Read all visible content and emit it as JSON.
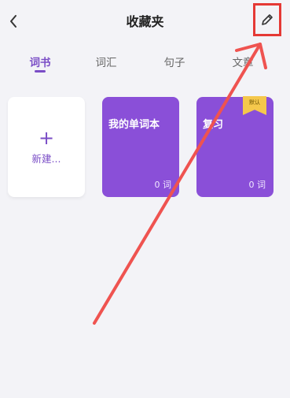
{
  "header": {
    "title": "收藏夹",
    "back_icon": "chevron-left-icon",
    "edit_icon": "pencil-icon"
  },
  "tabs": [
    {
      "label": "词书",
      "active": true
    },
    {
      "label": "词汇",
      "active": false
    },
    {
      "label": "句子",
      "active": false
    },
    {
      "label": "文章",
      "active": false
    }
  ],
  "cards": {
    "new_card": {
      "plus": "+",
      "label": "新建..."
    },
    "books": [
      {
        "name": "我的单词本",
        "count": "0 词"
      },
      {
        "name": "复习",
        "count": "0 词",
        "badge": "默认"
      }
    ]
  },
  "colors": {
    "accent": "#7a4dc6",
    "card_purple": "#8a4fd8",
    "badge_yellow": "#f5c84c",
    "annotation_red": "#e53935"
  }
}
